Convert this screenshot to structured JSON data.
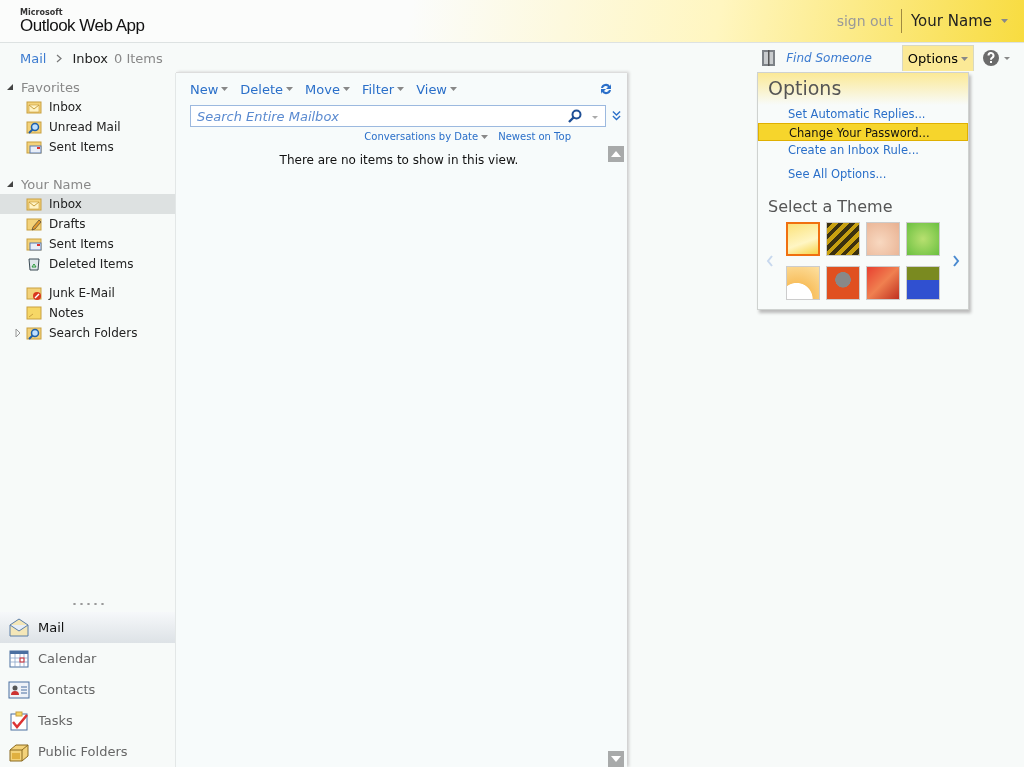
{
  "header": {
    "brand_small": "Microsoft",
    "brand": "Outlook Web App",
    "sign_out": "sign out",
    "user": "Your Name"
  },
  "breadcrumb": {
    "root": "Mail",
    "current": "Inbox",
    "count": "0 Items"
  },
  "top_links": {
    "find_someone": "Find Someone",
    "options": "Options",
    "options_open": true
  },
  "sidebar": {
    "sections": [
      {
        "title": "Favorites",
        "expanded": true,
        "groups": [
          [
            {
              "label": "Inbox",
              "kind": "inbox",
              "selected": false
            },
            {
              "label": "Unread Mail",
              "kind": "search",
              "selected": false
            },
            {
              "label": "Sent Items",
              "kind": "sent",
              "selected": false
            }
          ]
        ]
      },
      {
        "title": "Your Name",
        "expanded": true,
        "groups": [
          [
            {
              "label": "Inbox",
              "kind": "inbox",
              "selected": true
            },
            {
              "label": "Drafts",
              "kind": "drafts",
              "selected": false
            },
            {
              "label": "Sent Items",
              "kind": "sent",
              "selected": false
            },
            {
              "label": "Deleted Items",
              "kind": "deleted",
              "selected": false
            }
          ],
          [
            {
              "label": "Junk E-Mail",
              "kind": "junk",
              "selected": false
            },
            {
              "label": "Notes",
              "kind": "notes",
              "selected": false
            },
            {
              "label": "Search Folders",
              "kind": "search",
              "selected": false,
              "expanded": false
            }
          ]
        ]
      }
    ],
    "nav": [
      {
        "label": "Mail",
        "kind": "mail",
        "selected": true
      },
      {
        "label": "Calendar",
        "kind": "calendar",
        "selected": false
      },
      {
        "label": "Contacts",
        "kind": "contacts",
        "selected": false
      },
      {
        "label": "Tasks",
        "kind": "tasks",
        "selected": false
      },
      {
        "label": "Public Folders",
        "kind": "public",
        "selected": false
      }
    ]
  },
  "toolbar": [
    "New",
    "Delete",
    "Move",
    "Filter",
    "View"
  ],
  "search": {
    "placeholder": "Search Entire Mailbox"
  },
  "sort": {
    "arrangement": "Conversations by Date",
    "order": "Newest on Top"
  },
  "empty_message": "There are no items to show in this view.",
  "options_menu": {
    "title": "Options",
    "groups": [
      [
        {
          "label": "Set Automatic Replies...",
          "selected": false
        },
        {
          "label": "Change Your Password...",
          "selected": true
        },
        {
          "label": "Create an Inbox Rule...",
          "selected": false
        }
      ],
      [
        {
          "label": "See All Options...",
          "selected": false
        }
      ]
    ],
    "theme_title": "Select a Theme",
    "themes": [
      {
        "selected": true
      },
      {
        "selected": false
      },
      {
        "selected": false
      },
      {
        "selected": false
      },
      {
        "selected": false
      },
      {
        "selected": false
      },
      {
        "selected": false
      },
      {
        "selected": false
      }
    ]
  }
}
